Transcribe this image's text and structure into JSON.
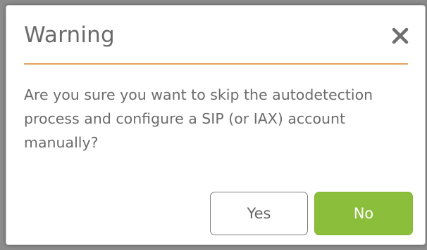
{
  "dialog": {
    "title": "Warning",
    "close_icon": "close-icon",
    "message": "Are you sure you want to skip the autodetection process and configure a SIP (or IAX) account manually?",
    "buttons": {
      "yes_label": "Yes",
      "no_label": "No"
    }
  },
  "colors": {
    "divider_accent": "#e8a05a",
    "primary_button": "#8bbe3a",
    "title_text": "#6a6a6a",
    "body_text": "#6b6b6b"
  }
}
